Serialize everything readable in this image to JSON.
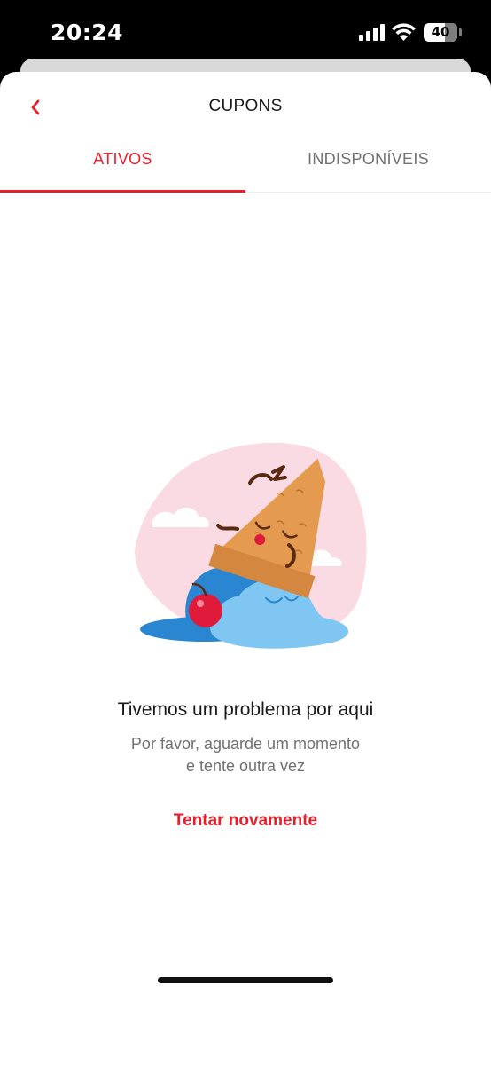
{
  "status_bar": {
    "time": "20:24",
    "battery": "40"
  },
  "header": {
    "title": "CUPONS"
  },
  "tabs": [
    {
      "label": "ATIVOS",
      "active": true
    },
    {
      "label": "INDISPONÍVEIS",
      "active": false
    }
  ],
  "error": {
    "title": "Tivemos um problema por aqui",
    "message_line1": "Por favor, aguarde um momento",
    "message_line2": "e tente outra vez",
    "retry_label": "Tentar novamente"
  },
  "colors": {
    "accent": "#ea1d2c",
    "muted_text": "#717171"
  }
}
